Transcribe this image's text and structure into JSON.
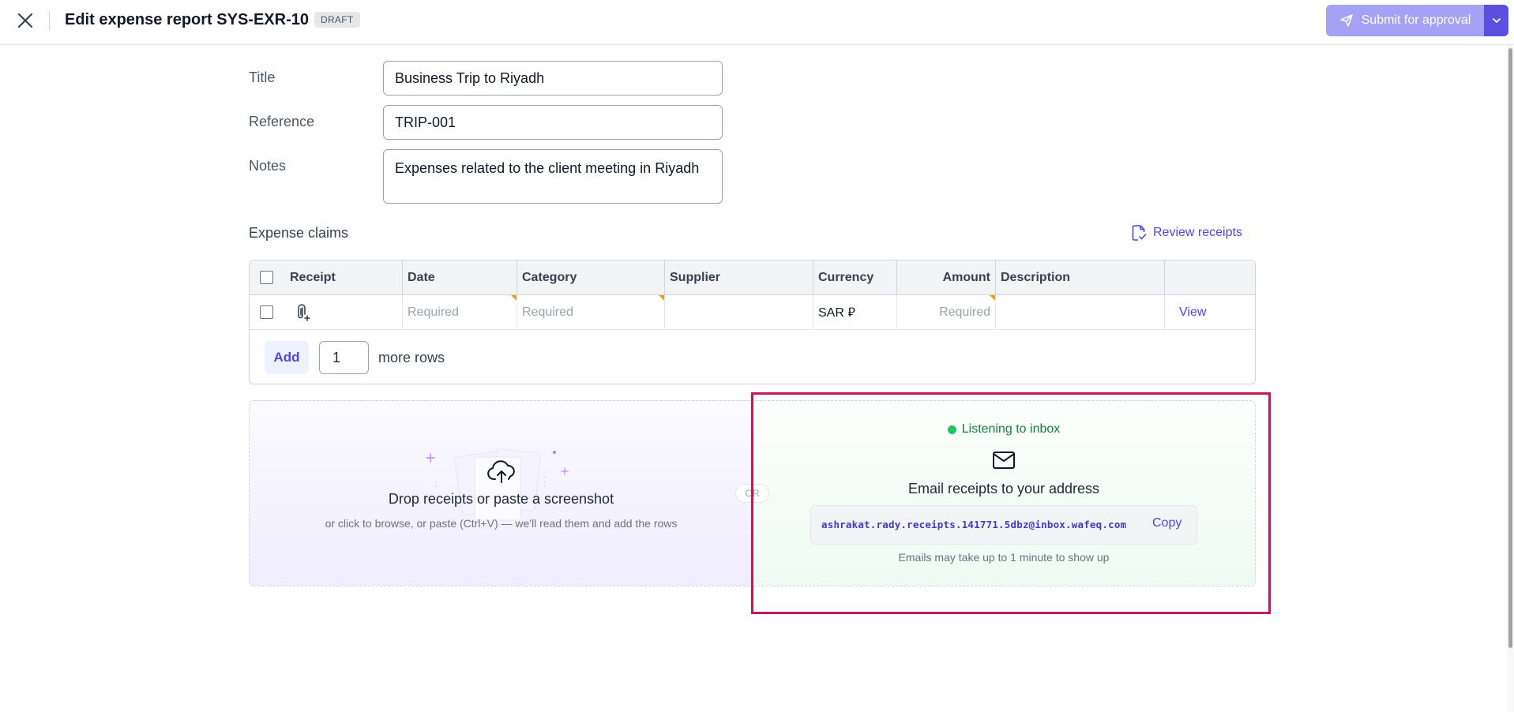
{
  "header": {
    "title": "Edit expense report SYS-EXR-10",
    "badge": "DRAFT",
    "submit_label": "Submit for approval"
  },
  "form": {
    "title_label": "Title",
    "title_value": "Business Trip to Riyadh",
    "reference_label": "Reference",
    "reference_value": "TRIP-001",
    "notes_label": "Notes",
    "notes_value": "Expenses related to the client meeting in Riyadh"
  },
  "claims": {
    "section_title": "Expense claims",
    "review_label": "Review receipts",
    "columns": [
      "Receipt",
      "Date",
      "Category",
      "Supplier",
      "Currency",
      "Amount",
      "Description"
    ],
    "row": {
      "date": "Required",
      "category": "Required",
      "supplier": "",
      "currency": "SAR ⃁",
      "amount": "Required",
      "description": "",
      "action": "View"
    },
    "add_label": "Add",
    "rows_value": "1",
    "more_rows_label": "more rows"
  },
  "upload": {
    "drop_title": "Drop receipts or paste a screenshot",
    "drop_subtitle": "or click to browse, or paste (Ctrl+V) — we'll read them and add the rows",
    "or_label": "OR",
    "listening_label": "Listening to inbox",
    "email_title": "Email receipts to your address",
    "email_address": "ashrakat.rady.receipts.141771.5dbz@inbox.wafeq.com",
    "copy_label": "Copy",
    "email_note": "Emails may take up to 1 minute to show up"
  },
  "colors": {
    "accent": "#4f46e5",
    "submit_disabled": "#a5a1f5",
    "highlight": "#c2185b",
    "listening": "#22c55e"
  }
}
